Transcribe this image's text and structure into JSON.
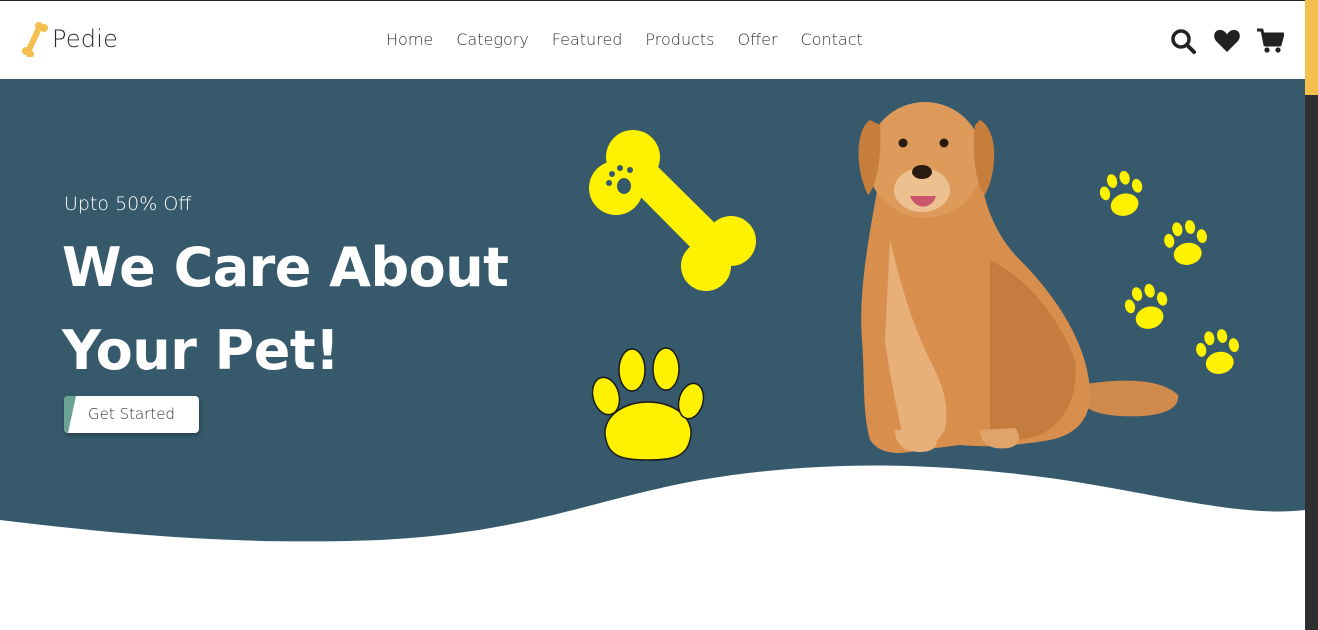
{
  "brand": {
    "name": "Pedie",
    "logo_icon": "bone-icon",
    "logo_color": "#f5bf4f"
  },
  "nav": {
    "items": [
      {
        "label": "Home"
      },
      {
        "label": "Category"
      },
      {
        "label": "Featured"
      },
      {
        "label": "Products"
      },
      {
        "label": "Offer"
      },
      {
        "label": "Contact"
      }
    ]
  },
  "header_icons": [
    "search-icon",
    "heart-icon",
    "cart-icon"
  ],
  "hero": {
    "offer_text": "Upto 50% Off",
    "headline_line1": "We Care About",
    "headline_line2": "Your Pet!",
    "cta_label": "Get Started",
    "background_color": "#36596c",
    "accent_color": "#fff200",
    "cta_accent": "#6aa392"
  },
  "scrollbar": {
    "thumb_color": "#f5bf4f",
    "track_color": "#2f2f2f"
  }
}
